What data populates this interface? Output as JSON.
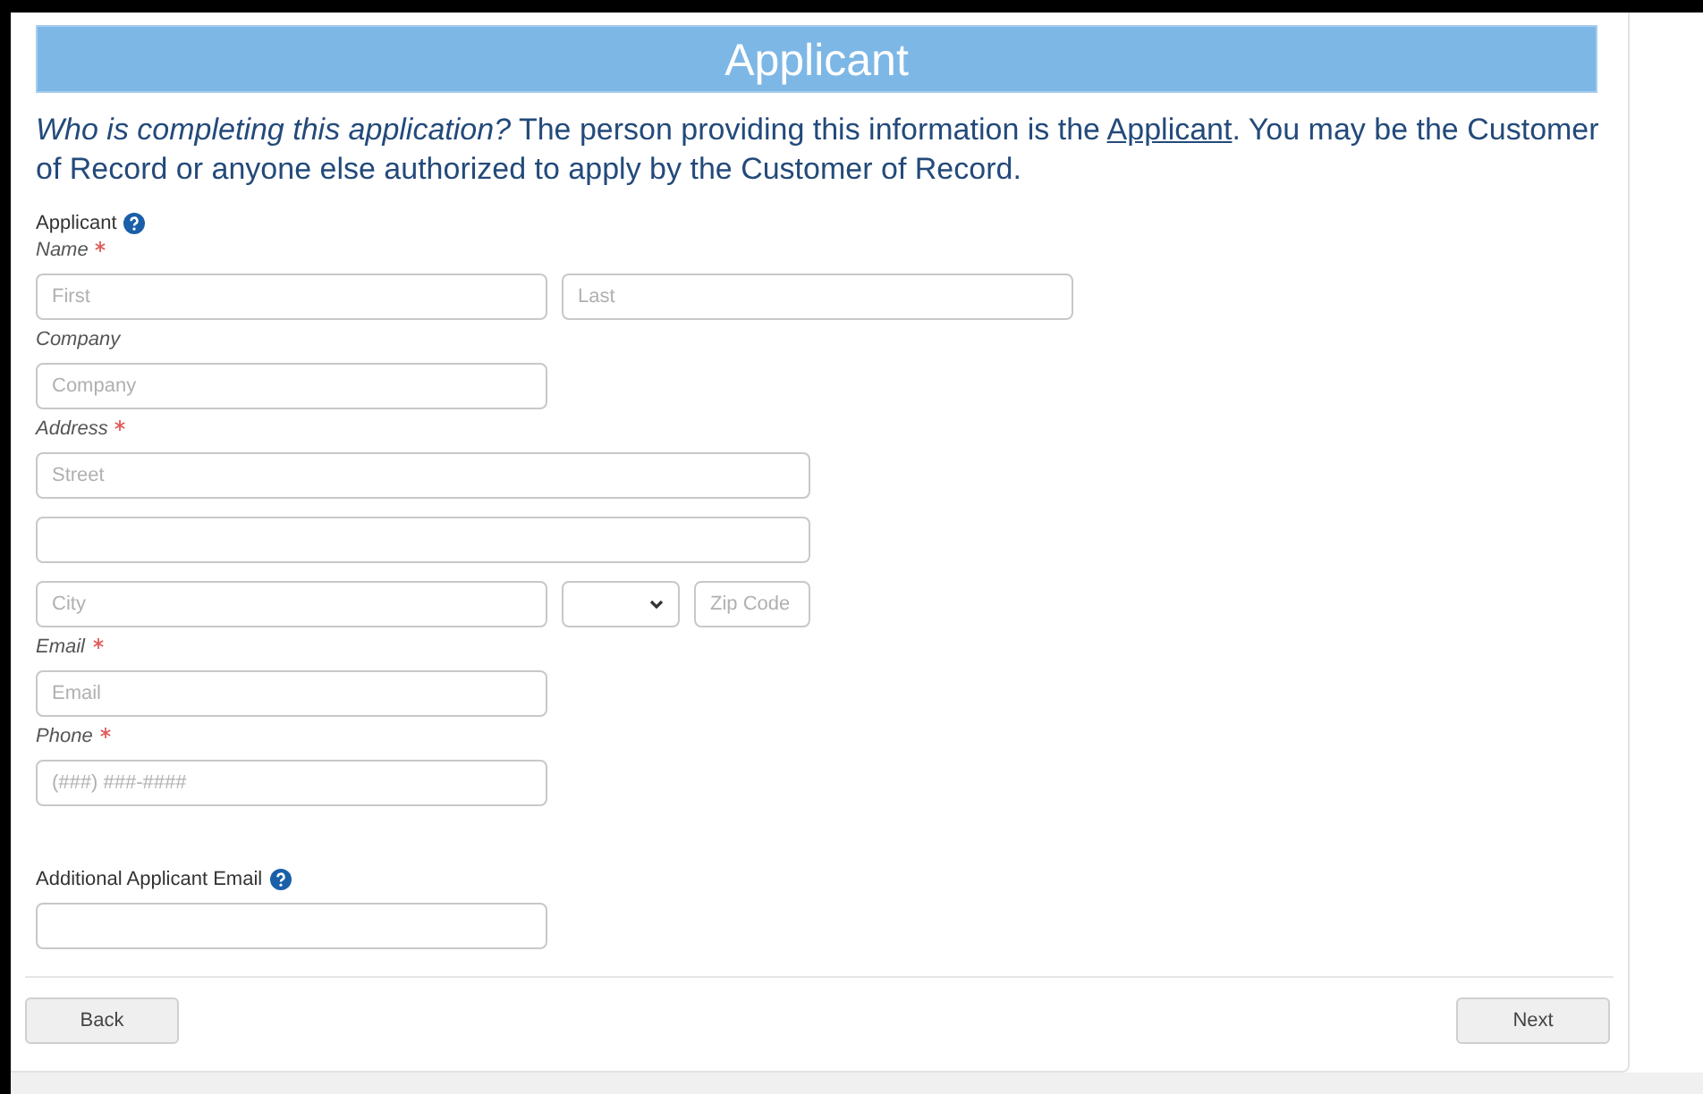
{
  "header": {
    "title": "Applicant"
  },
  "intro": {
    "before": "*Who is completing this application?* The person providing this information is the ",
    "link": "Applicant",
    "after": ". You may be the Customer of Record or anyone else authorized to apply by the Customer of Record."
  },
  "section": {
    "label": "Applicant",
    "help": true
  },
  "groups": [
    {
      "label": "Name",
      "required": true,
      "rows": [
        [
          {
            "kind": "half",
            "placeholder": "First"
          },
          {
            "kind": "half",
            "placeholder": "Last"
          }
        ]
      ]
    },
    {
      "label": "Company",
      "required": false,
      "rows": [
        [
          {
            "kind": "half",
            "placeholder": "Company"
          }
        ]
      ]
    },
    {
      "label": "Address",
      "required": true,
      "rows": [
        [
          {
            "kind": "wide",
            "placeholder": "Street"
          }
        ],
        [
          {
            "kind": "wide"
          }
        ],
        [
          {
            "kind": "half",
            "placeholder": "City"
          },
          {
            "kind": "select"
          },
          {
            "kind": "zip",
            "placeholder": "Zip Code"
          }
        ]
      ]
    },
    {
      "label": "Email",
      "required": true,
      "rows": [
        [
          {
            "kind": "half",
            "placeholder": "Email"
          }
        ]
      ]
    },
    {
      "label": "Phone",
      "required": true,
      "rows": [
        [
          {
            "kind": "half",
            "placeholder": "(###) ###-####"
          }
        ]
      ]
    }
  ],
  "additional": {
    "label": "Additional Applicant Email",
    "help": true
  },
  "buttons": {
    "back": "Back",
    "next": "Next"
  }
}
